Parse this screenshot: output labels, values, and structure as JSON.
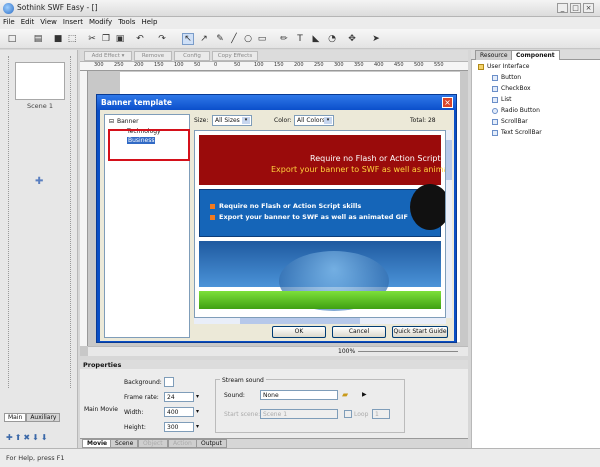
{
  "app": {
    "title": "Sothink SWF Easy - []",
    "controls": [
      "_",
      "□",
      "×"
    ]
  },
  "menu": [
    "File",
    "Edit",
    "View",
    "Insert",
    "Modify",
    "Tools",
    "Help"
  ],
  "effects": {
    "add": "Add Effect ▾",
    "remove": "Remove",
    "config": "Config",
    "copy": "Copy Effects"
  },
  "ruler": [
    "300",
    "250",
    "200",
    "150",
    "100",
    "50",
    "0",
    "50",
    "100",
    "150",
    "200",
    "250",
    "300",
    "350",
    "400",
    "450",
    "500",
    "550"
  ],
  "scene": {
    "label": "Scene 1"
  },
  "left_tabs": [
    "Main",
    "Auxiliary"
  ],
  "dialog": {
    "title": "Banner template",
    "tree": {
      "root": "Banner",
      "children": [
        "Technology",
        "Business"
      ]
    },
    "size_label": "Size:",
    "size_value": "All Sizes",
    "color_label": "Color:",
    "color_value": "All Colors",
    "total": "Total: 28",
    "banner1": {
      "line1": "Require no Flash or Action Script",
      "line2": "Export your banner to SWF as well as anima"
    },
    "banner2": {
      "line1": "Require no Flash or Action Script skills",
      "line2": "Export your banner to SWF as well as animated GIF"
    },
    "ok": "OK",
    "cancel": "Cancel",
    "quick": "Quick Start Guide"
  },
  "zoom": "100%",
  "right_tabs": [
    "Resource",
    "Component"
  ],
  "components": {
    "root": "User Interface",
    "items": [
      "Button",
      "CheckBox",
      "List",
      "Radio Button",
      "ScrollBar",
      "Text ScrollBar"
    ]
  },
  "properties": {
    "header": "Properties",
    "section": "Main Movie",
    "background_label": "Background:",
    "frame_rate_label": "Frame rate:",
    "frame_rate": "24",
    "width_label": "Width:",
    "width": "400",
    "height_label": "Height:",
    "height": "300",
    "stream_title": "Stream sound",
    "sound_label": "Sound:",
    "sound_value": "None",
    "start_scene_label": "Start scene:",
    "start_scene_value": "Scene 1",
    "loop_label": "Loop",
    "loop_value": "1"
  },
  "prop_tabs": [
    "Movie",
    "Scene",
    "Object",
    "Action",
    "Output"
  ],
  "status": "For Help, press F1"
}
